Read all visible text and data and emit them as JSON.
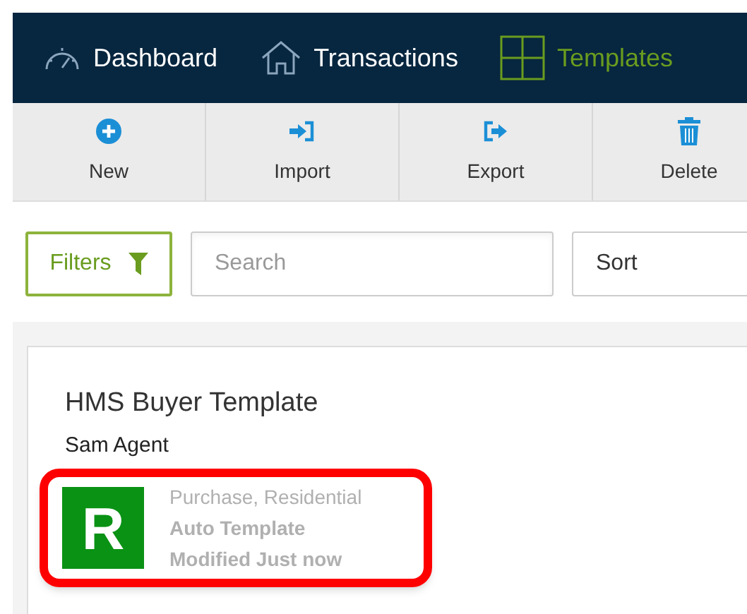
{
  "nav": [
    {
      "label": "Dashboard",
      "kind": "gauge",
      "selected": false
    },
    {
      "label": "Transactions",
      "kind": "house",
      "selected": false
    },
    {
      "label": "Templates",
      "kind": "grid",
      "selected": true
    }
  ],
  "toolbar": [
    {
      "label": "New",
      "kind": "plus"
    },
    {
      "label": "Import",
      "kind": "import"
    },
    {
      "label": "Export",
      "kind": "export"
    },
    {
      "label": "Delete",
      "kind": "trash"
    }
  ],
  "filters": {
    "label": "Filters"
  },
  "search": {
    "placeholder": "Search"
  },
  "sort": {
    "value": "Sort"
  },
  "card": {
    "title": "HMS Buyer Template",
    "owner": "Sam Agent",
    "badge": "R",
    "highlighted": true,
    "details": [
      {
        "text": "Purchase, Residential",
        "bold": false
      },
      {
        "text": "Auto Template",
        "bold": true
      },
      {
        "text": "Modified Just now",
        "bold": true
      }
    ]
  }
}
